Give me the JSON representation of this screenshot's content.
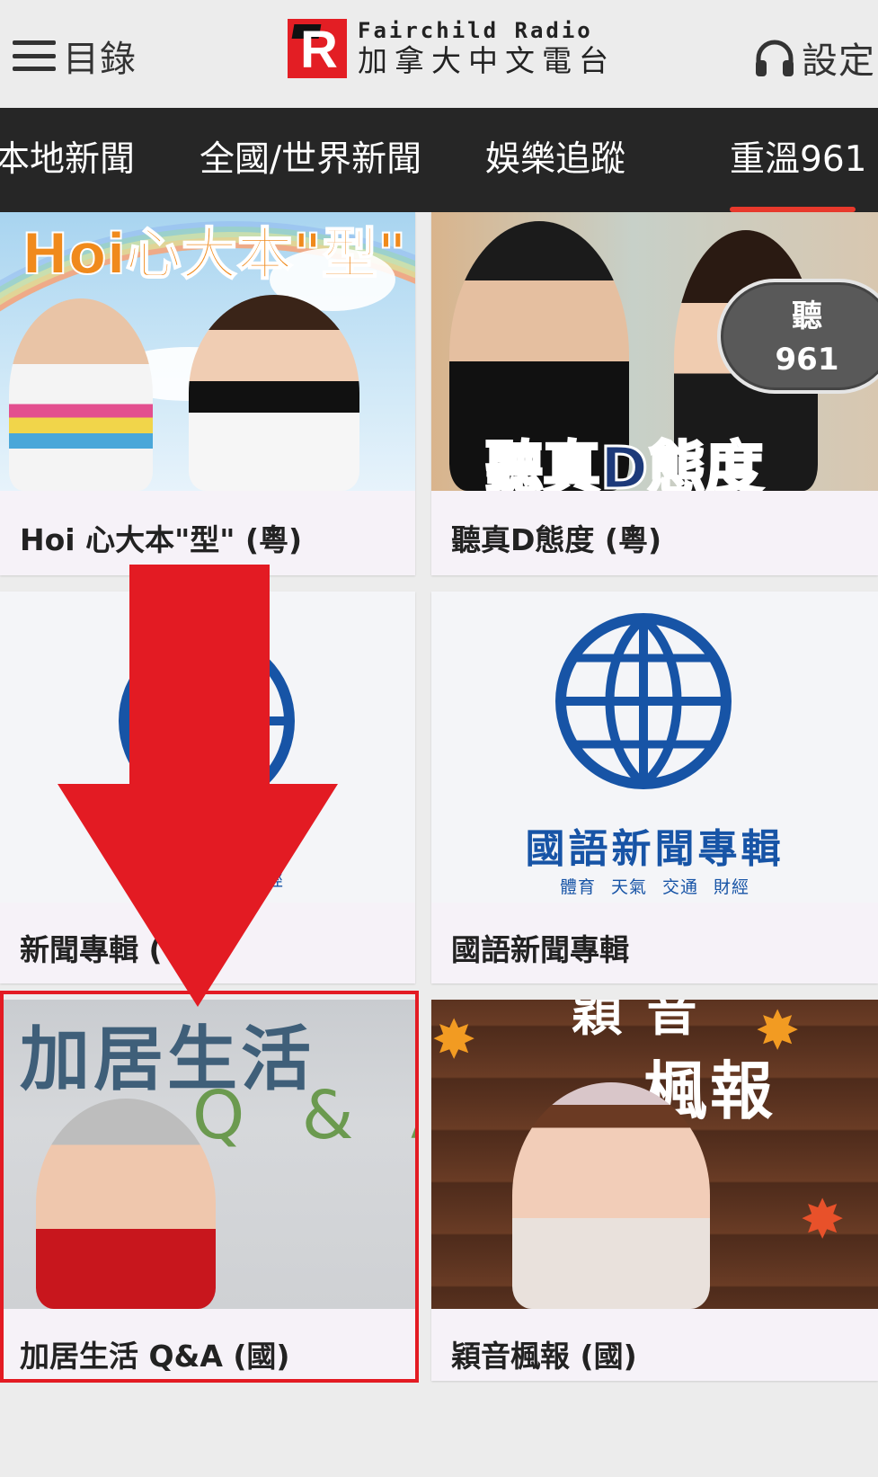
{
  "header": {
    "menu_label": "目錄",
    "logo_en": "Fairchild Radio",
    "logo_zh": "加拿大中文電台",
    "settings_label": "設定"
  },
  "tabs": [
    {
      "label": "本地新聞"
    },
    {
      "label": "全國/世界新聞"
    },
    {
      "label": "娛樂追蹤"
    },
    {
      "label": "重溫961",
      "active": true
    }
  ],
  "cards": [
    {
      "title": "Hoi 心大本\"型\" (粵)",
      "banner": "Hoi心大本\"型\""
    },
    {
      "title": "聽真D態度 (粵)",
      "banner": "聽真D態度",
      "badge_top": "聽",
      "badge_bottom": "961"
    },
    {
      "title": "新聞專輯 (",
      "subtitle_fragment": "經"
    },
    {
      "title": "國語新聞專輯",
      "logo_title": "國語新聞專輯",
      "logo_subtitle": "體育 天氣 交通 財經"
    },
    {
      "title": "加居生活 Q&A (國)",
      "banner_main": "加居生活",
      "banner_sub": "Q & A"
    },
    {
      "title": "穎音楓報 (國)",
      "banner_top": "穎 音",
      "banner_main": "楓報"
    }
  ],
  "colors": {
    "accent_red": "#e31b23",
    "tab_underline": "#e8392c",
    "tabbar_bg": "#262626",
    "news_blue": "#1754a6"
  },
  "annotations": {
    "arrow": "down-arrow",
    "highlight": "highlight-box"
  }
}
